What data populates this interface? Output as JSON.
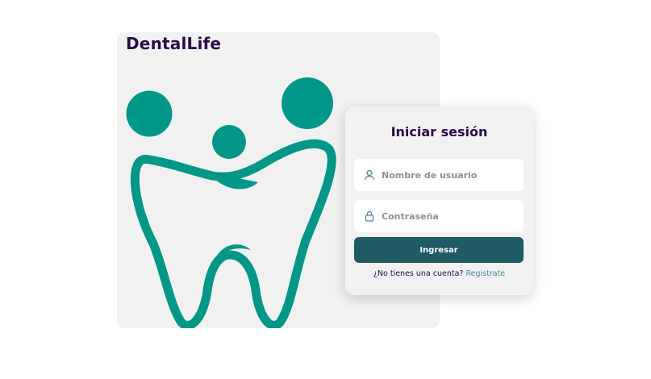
{
  "brand": {
    "title": "DentalLife",
    "logo_icon": "tooth-family-logo",
    "logo_color": "#009688"
  },
  "login": {
    "title": "Iniciar sesión",
    "username": {
      "placeholder": "Nombre de usuario",
      "value": "",
      "icon": "user-icon"
    },
    "password": {
      "placeholder": "Contraseña",
      "value": "",
      "icon": "lock-icon"
    },
    "submit_label": "Ingresar",
    "signup_prompt": "¿No tienes una cuenta?",
    "signup_link": "Registrate"
  },
  "colors": {
    "primary_button": "#1e5b62",
    "heading": "#2a0b4a",
    "link": "#4a8a9a",
    "panel_bg": "#f1f1f2"
  }
}
